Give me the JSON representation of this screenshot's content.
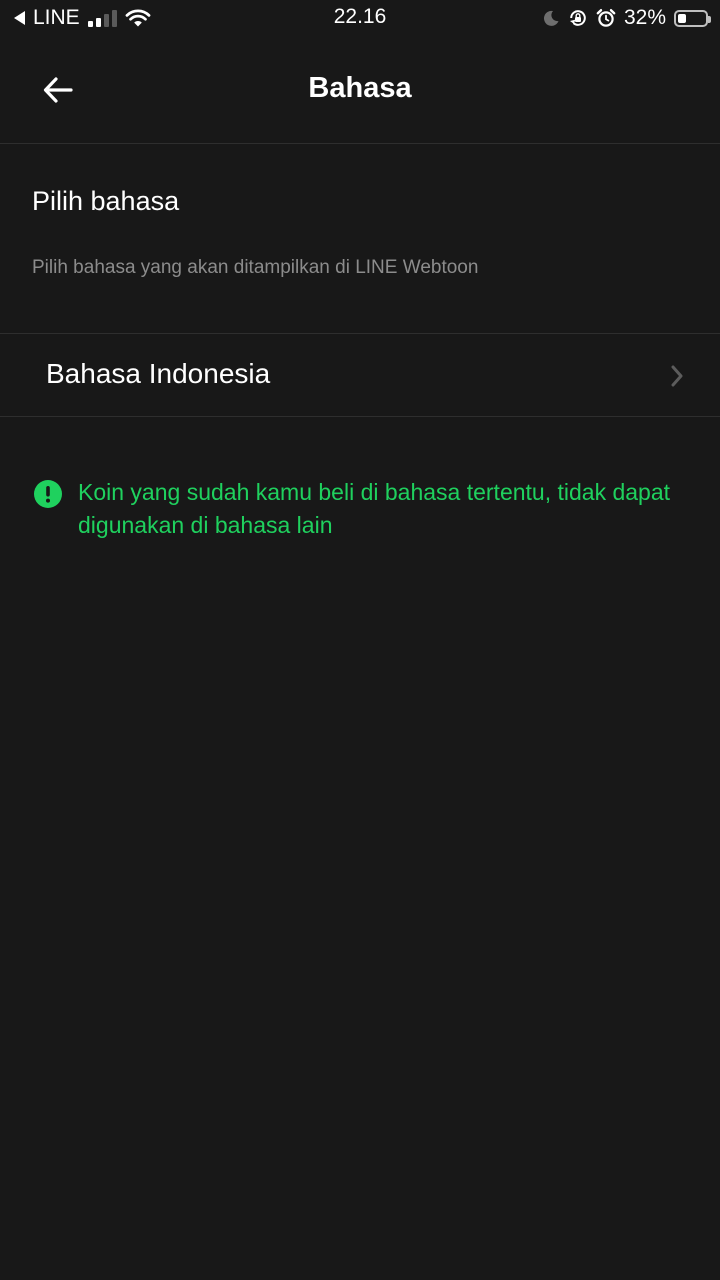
{
  "status_bar": {
    "carrier": "LINE",
    "time": "22.16",
    "battery_percent": "32%",
    "battery_level": 0.32,
    "signal_bars_active": 2,
    "signal_bars_total": 4,
    "icons": [
      "back-to-app-icon",
      "signal-icon",
      "wifi-icon",
      "moon-icon",
      "orientation-lock-icon",
      "alarm-icon",
      "battery-icon"
    ]
  },
  "header": {
    "title": "Bahasa",
    "back_icon": "arrow-left-icon"
  },
  "section": {
    "title": "Pilih bahasa",
    "description": "Pilih bahasa yang akan ditampilkan di LINE Webtoon"
  },
  "language_row": {
    "label": "Bahasa Indonesia",
    "icon": "chevron-right-icon"
  },
  "notice": {
    "icon": "exclamation-circle-icon",
    "text": "Koin yang sudah kamu beli di bahasa tertentu, tidak dapat digunakan di bahasa lain"
  },
  "colors": {
    "background": "#181818",
    "divider": "#2e2e2e",
    "text_primary": "#ffffff",
    "text_secondary": "#8c8c8c",
    "accent_green": "#1fd15e"
  }
}
